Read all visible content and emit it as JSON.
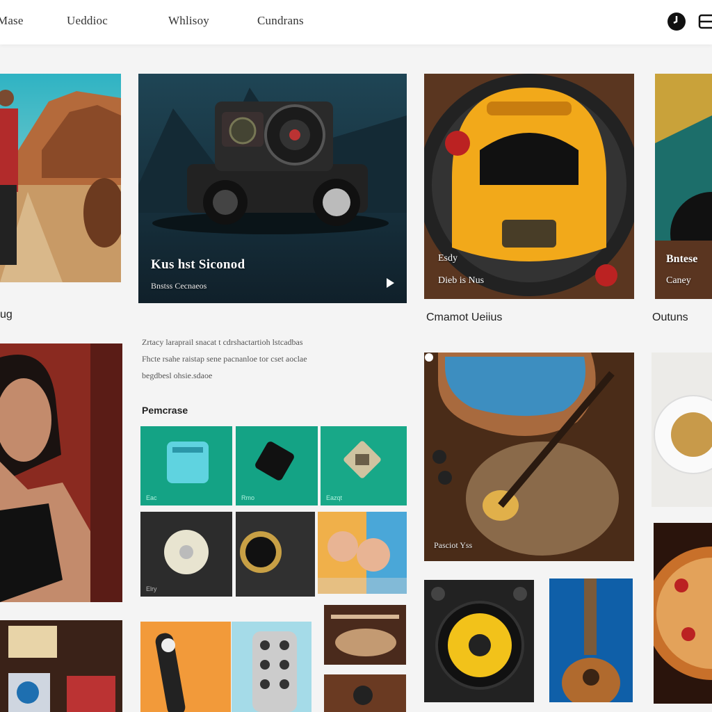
{
  "nav": {
    "items": [
      "Mase",
      "Ueddioc",
      "Whlisoy",
      "Cundrans"
    ]
  },
  "header_icons": [
    "clock-icon",
    "menu-icon"
  ],
  "cards": {
    "featured": {
      "title": "Kus hst Siconod",
      "subtitle": "Bnstss Cecnaeos"
    },
    "yellow_car": {
      "line1": "Esdy",
      "line2": "Dieb is Nus",
      "caption": "Cmamot Ueiius"
    },
    "right_top": {
      "line1": "Bntese",
      "line2": "Caney",
      "caption": "Outuns"
    },
    "left_top": {
      "caption": "ug"
    },
    "guitar": {
      "label": "Pasciot Yss"
    }
  },
  "description": [
    "Zrtacy laraprail snacat t cdrshactartioh lstcadbas",
    "Fhcte rsahe raistap sene pacnanloe tor cset aoclae",
    "begdbesl ohsie.sdaoe"
  ],
  "section": {
    "label": "Pemcrase"
  },
  "tiles": {
    "t1": "Eac",
    "t2": "Rmo",
    "t3": "Eazqt",
    "t4": "Elry"
  },
  "colors": {
    "teal": "#19a58a",
    "dark_navy": "#1a2f3d",
    "yellow": "#f2a91a",
    "orange": "#f39a3c"
  }
}
